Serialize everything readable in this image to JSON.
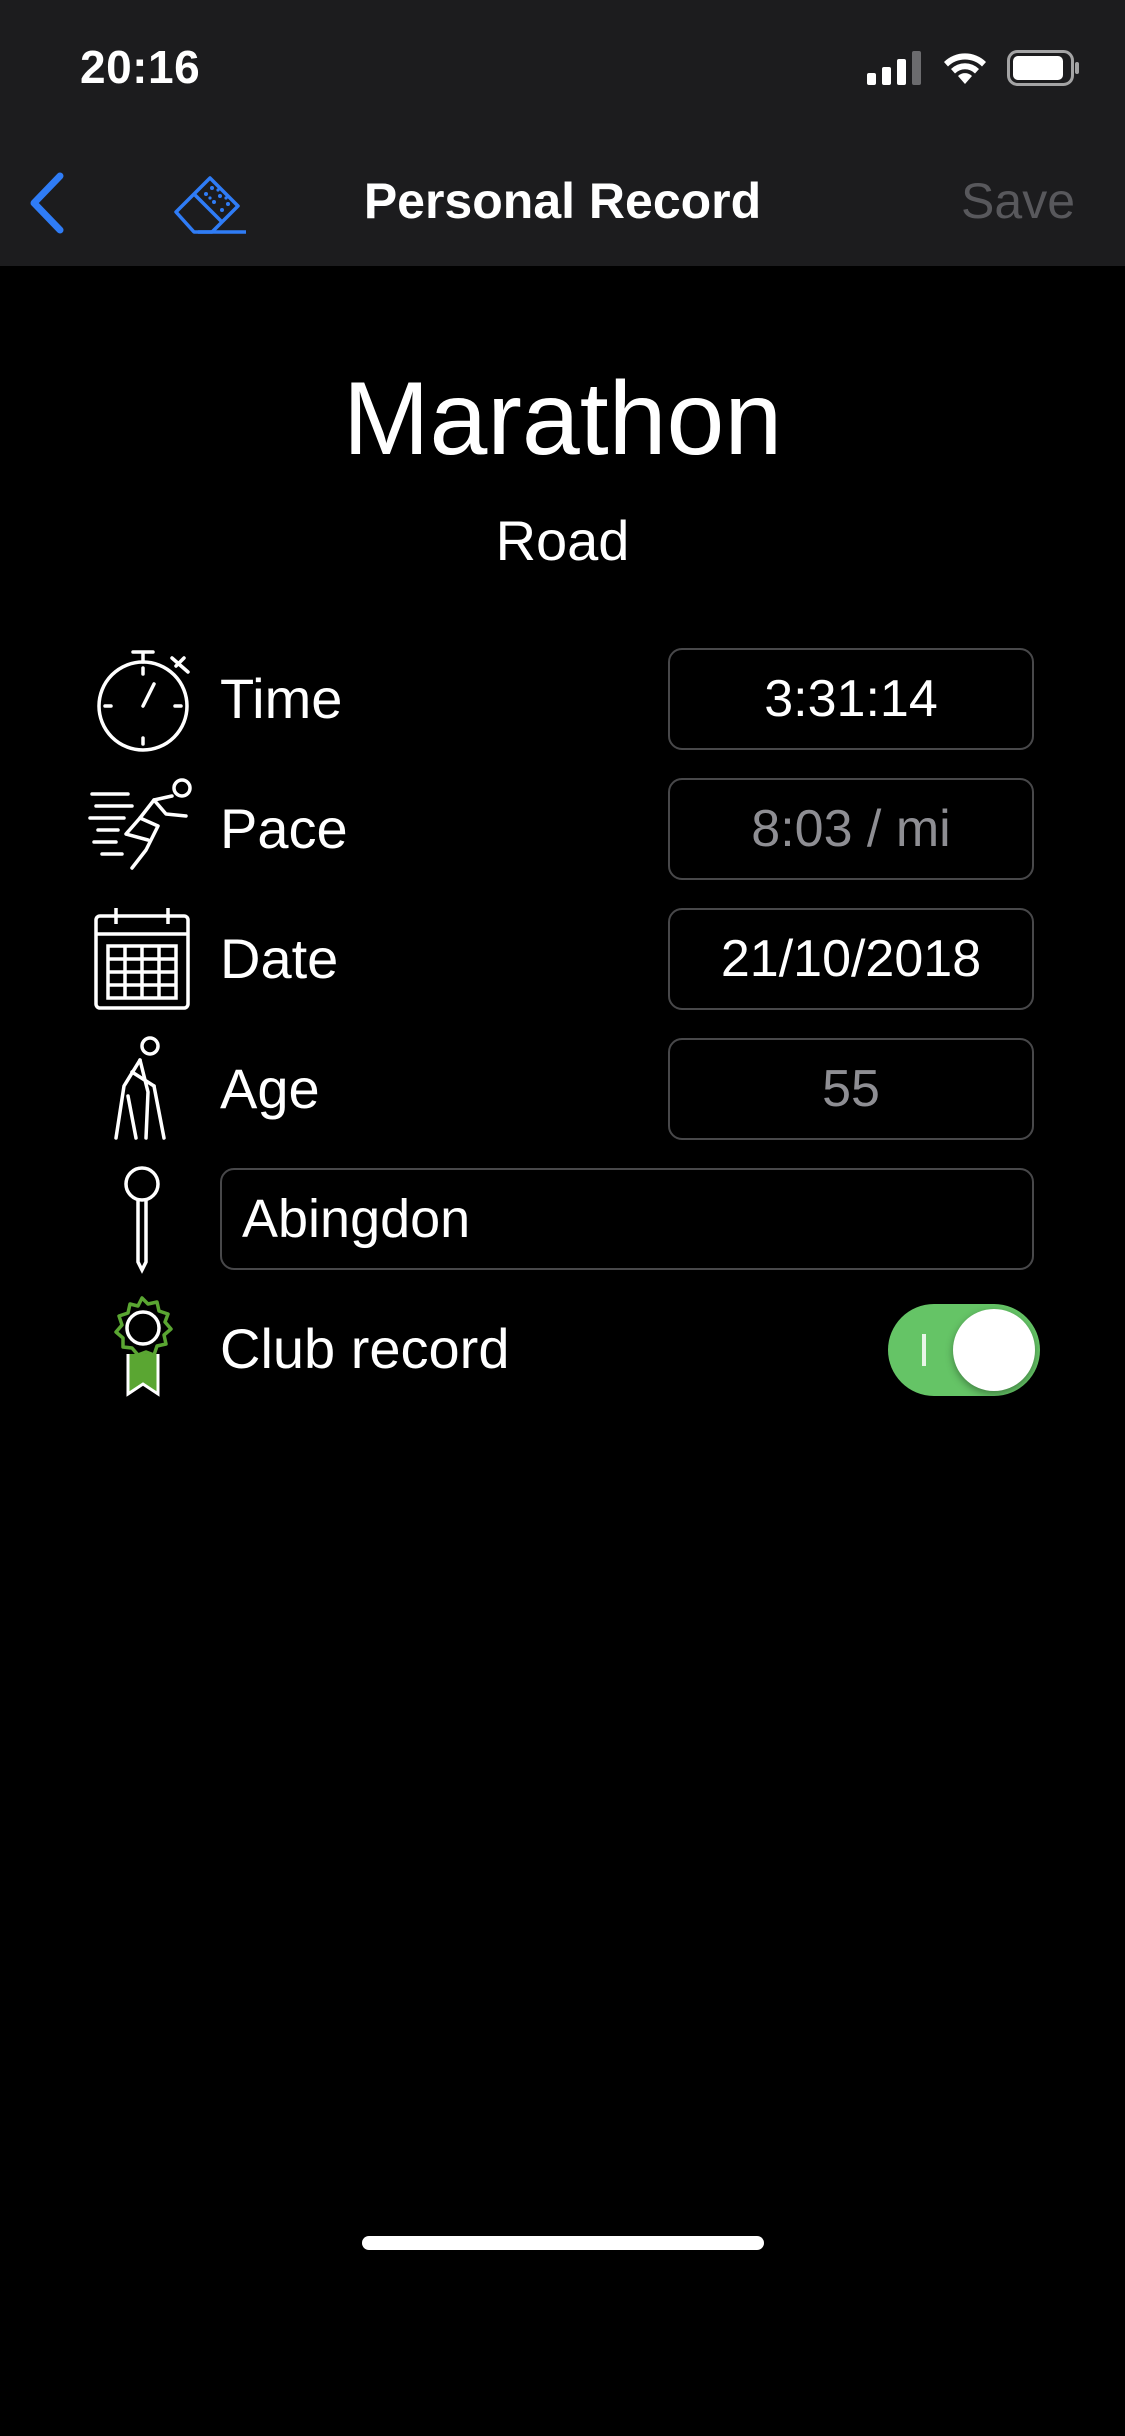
{
  "status": {
    "time": "20:16"
  },
  "nav": {
    "title": "Personal Record",
    "save_label": "Save"
  },
  "event": {
    "name": "Marathon",
    "type": "Road"
  },
  "rows": {
    "time": {
      "label": "Time",
      "value": "3:31:14"
    },
    "pace": {
      "label": "Pace",
      "value": "8:03 / mi"
    },
    "date": {
      "label": "Date",
      "value": "21/10/2018"
    },
    "age": {
      "label": "Age",
      "value": "55"
    },
    "location": {
      "value": "Abingdon"
    },
    "club_record": {
      "label": "Club record",
      "on": true
    }
  },
  "colors": {
    "accent": "#2f7cf6",
    "toggle_on": "#65c466",
    "badge_green": "#5aa632"
  }
}
